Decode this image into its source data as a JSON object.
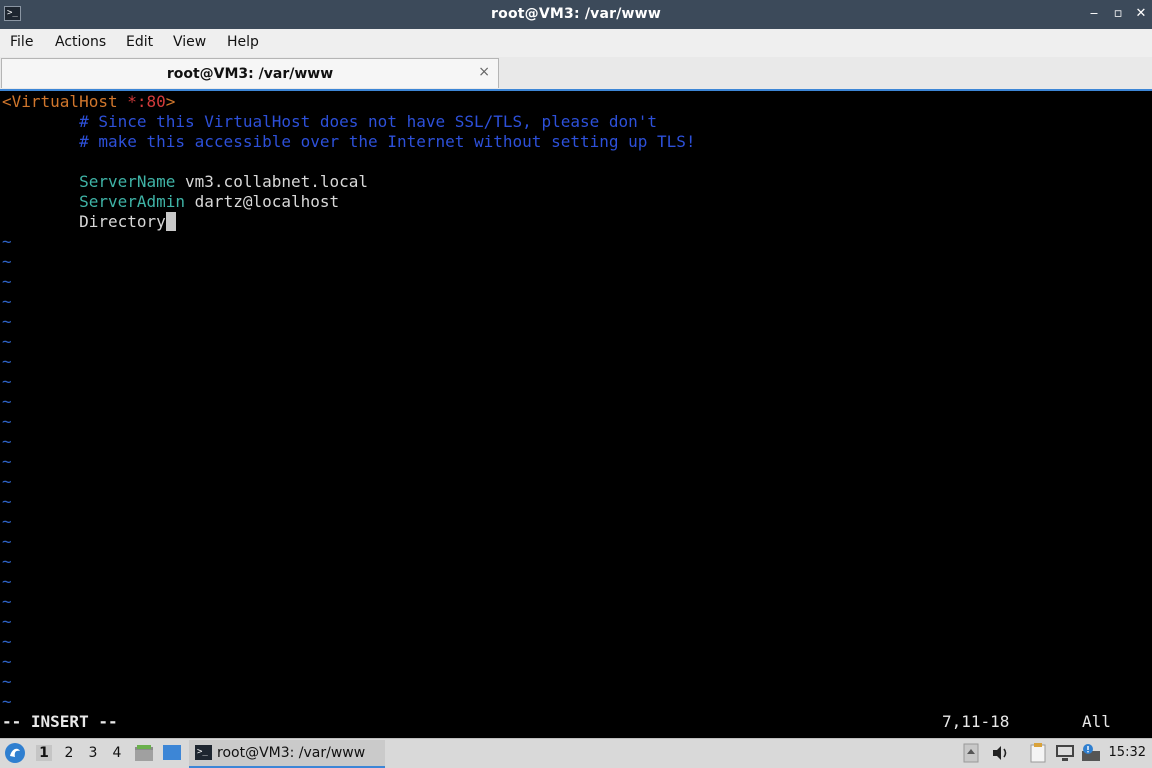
{
  "window": {
    "title": "root@VM3: /var/www",
    "app_icon_glyph": ">_",
    "minimize_glyph": "‒",
    "restore_glyph": "▫",
    "close_glyph": "✕"
  },
  "menu": {
    "items": [
      "File",
      "Actions",
      "Edit",
      "View",
      "Help"
    ]
  },
  "tab": {
    "label": "root@VM3: /var/www",
    "close_glyph": "×"
  },
  "editor": {
    "lines": {
      "l1_tag_open": "<VirtualHost ",
      "l1_port": "*:80",
      "l1_tag_close": ">",
      "l2_comment": "        # Since this VirtualHost does not have SSL/TLS, please don't",
      "l3_comment": "        # make this accessible over the Internet without setting up TLS!",
      "l5_indent": "        ",
      "l5_key": "ServerName",
      "l5_value": " vm3.collabnet.local",
      "l6_indent": "        ",
      "l6_key": "ServerAdmin",
      "l6_value": " dartz@localhost",
      "l7_indent": "        ",
      "l7_text": "Directory"
    },
    "tilde": "~",
    "mode": "-- INSERT --",
    "position": "7,11-18",
    "scroll": "All"
  },
  "taskbar": {
    "workspaces": [
      "1",
      "2",
      "3",
      "4"
    ],
    "active_workspace": "1",
    "task_label": "root@VM3: /var/www",
    "task_icon_glyph": ">_",
    "clock": "15:32"
  },
  "colors": {
    "titlebar": "#3c4a5a",
    "accent": "#3d86d6",
    "comment": "#2d50d9",
    "keyword": "#3fb3a6",
    "tag": "#d0762c"
  }
}
